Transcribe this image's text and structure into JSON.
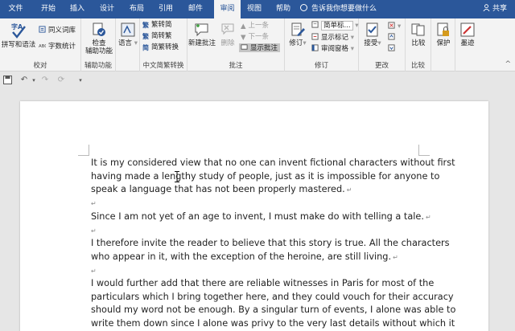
{
  "menu": {
    "tabs": [
      "文件",
      "开始",
      "插入",
      "设计",
      "布局",
      "引用",
      "邮件",
      "审阅",
      "视图",
      "帮助"
    ],
    "active_tab": "审阅",
    "tell_me": "告诉我你想要做什么",
    "share": "共享"
  },
  "ribbon": {
    "proofing": {
      "label": "校对",
      "spelling": "拼写和语法",
      "thesaurus": "同义词库",
      "word_count": "字数统计"
    },
    "accessibility": {
      "label": "辅助功能",
      "check_line1": "检查",
      "check_line2": "辅助功能"
    },
    "language": {
      "label": "",
      "language_btn": "语言"
    },
    "chinese_conversion": {
      "label": "中文简繁转换",
      "to_simplified": "繁转简",
      "to_traditional": "简转繁",
      "convert": "简繁转换"
    },
    "comments": {
      "label": "批注",
      "new_comment": "新建批注",
      "delete": "删除",
      "previous": "上一条",
      "next": "下一条",
      "show_comments": "显示批注"
    },
    "tracking": {
      "label": "修订",
      "track_changes": "修订",
      "display_for_review": "简单标...",
      "show_markup": "显示标记",
      "reviewing_pane": "审阅窗格"
    },
    "changes": {
      "label": "更改",
      "accept": "接受"
    },
    "compare": {
      "label": "比较",
      "compare_btn": "比较"
    },
    "protect": {
      "label": "",
      "protect_btn": "保护"
    },
    "ink": {
      "label": "",
      "ink_btn": "墨迹"
    }
  },
  "document": {
    "paragraphs": [
      {
        "lines": [
          "It is my considered view that no one can invent fictional characters without first",
          "having made a lengthy study of people, just as it is impossible for anyone to",
          "speak a language that has not been properly mastered."
        ],
        "pilcrow": "↵"
      },
      {
        "lines": [
          "Since I am not yet of an age to invent, I must make do with telling a tale."
        ],
        "pilcrow": "↵"
      },
      {
        "lines": [
          "I therefore invite the reader to believe that this story is true. All the characters",
          "who appear in it, with the exception of the heroine, are still living."
        ],
        "pilcrow": "↵"
      },
      {
        "lines": [
          "I would further add that there are reliable witnesses in Paris for most of the",
          "particulars which I bring together here, and they could vouch for their accuracy",
          "should my word not be enough. By a singular turn of events, I alone was able to",
          "write them down since I alone was privy to the very last details without which it"
        ],
        "pilcrow": ""
      }
    ],
    "empty_pilcrow": "↵"
  },
  "colors": {
    "title_bar": "#2b579a",
    "ribbon_bg": "#f3f3f3",
    "canvas_bg": "#e6e6e6",
    "page_bg": "#ffffff"
  }
}
